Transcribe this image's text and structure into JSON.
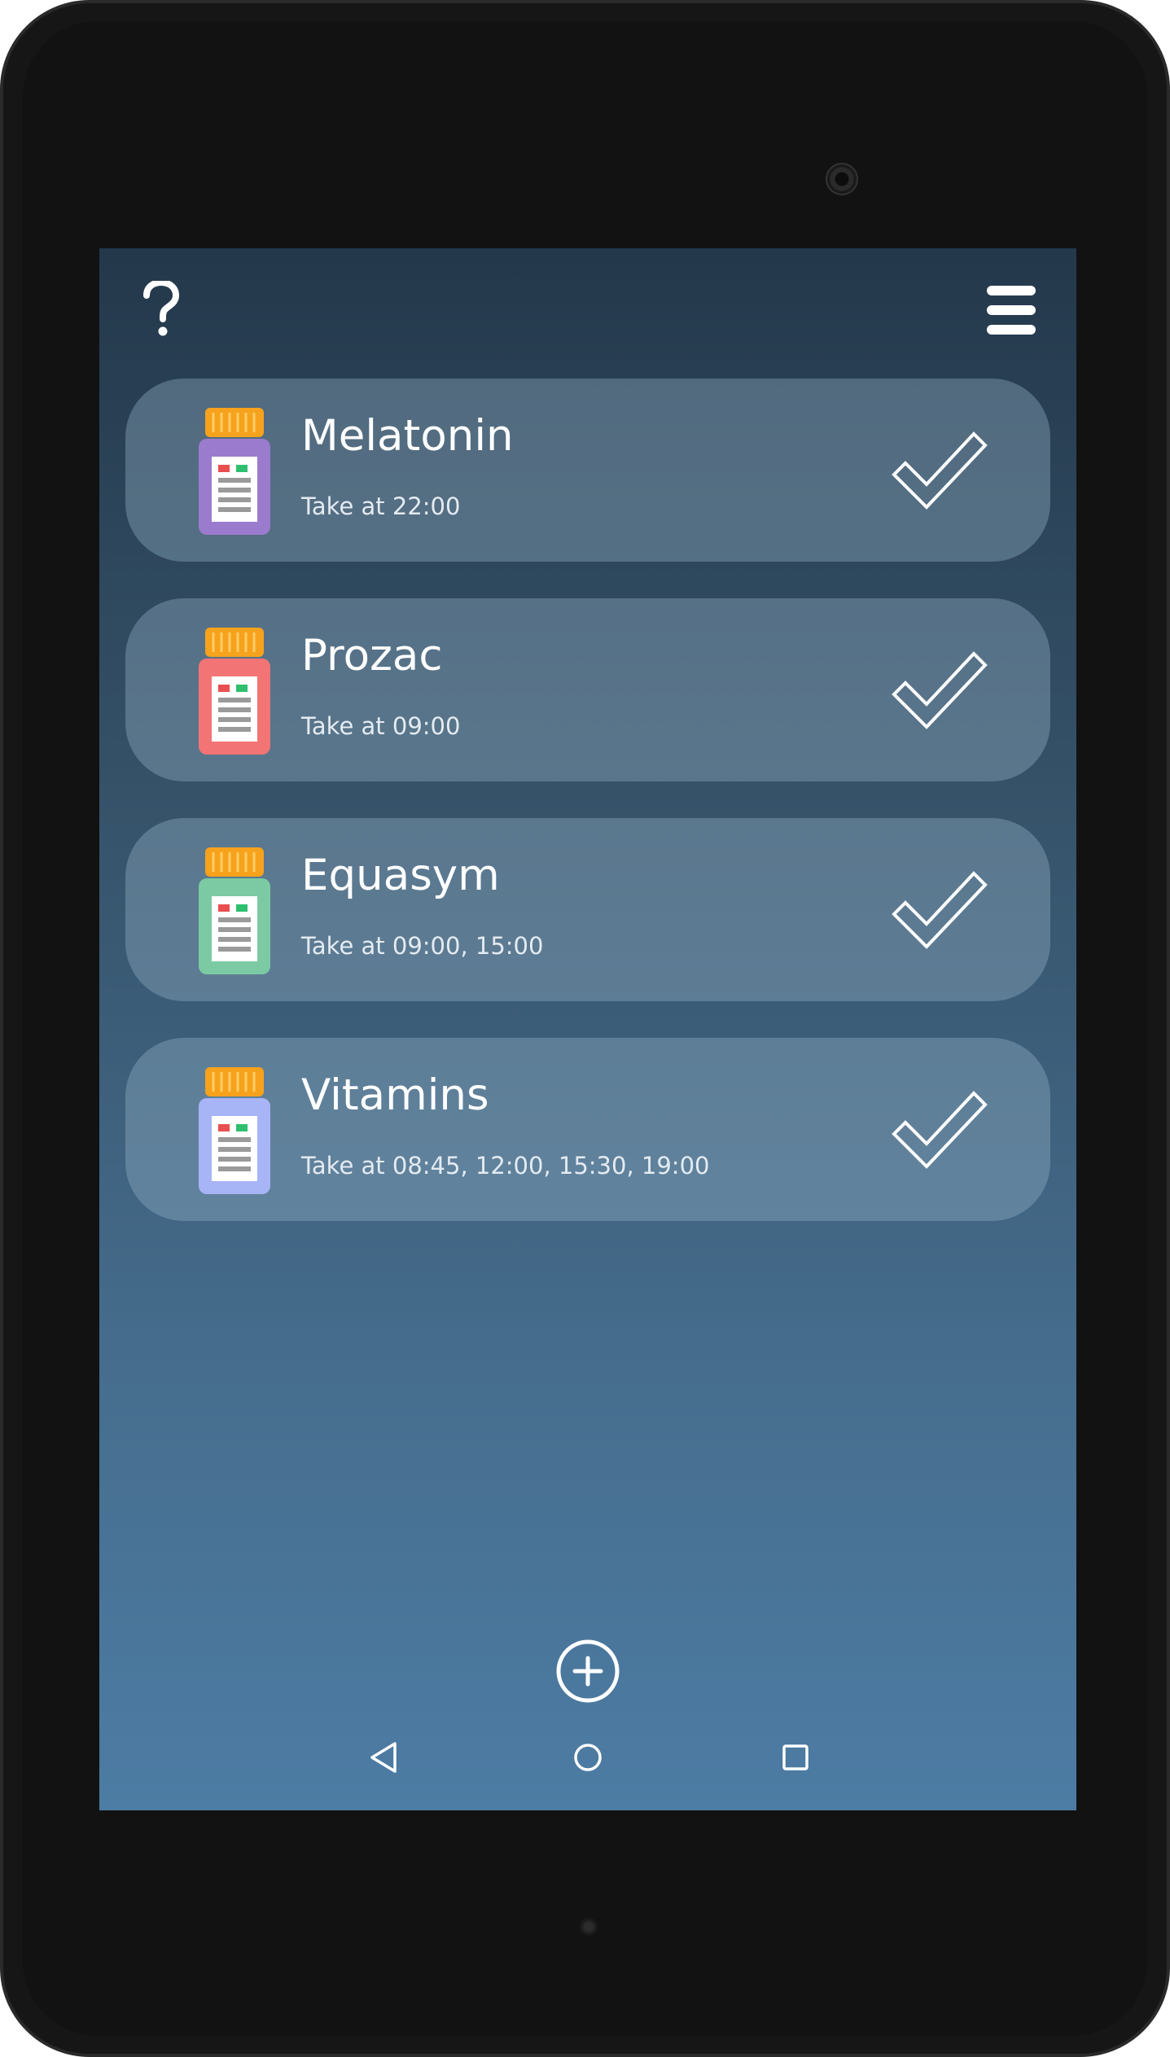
{
  "header": {
    "help_icon": "question-mark-icon",
    "menu_icon": "hamburger-menu-icon"
  },
  "medications": [
    {
      "name": "Melatonin",
      "schedule": "Take at 22:00",
      "bottle_color": "#9b7bcd"
    },
    {
      "name": "Prozac",
      "schedule": "Take at 09:00",
      "bottle_color": "#f37474"
    },
    {
      "name": "Equasym",
      "schedule": "Take at 09:00, 15:00",
      "bottle_color": "#7ccaa3"
    },
    {
      "name": "Vitamins",
      "schedule": "Take at 08:45, 12:00, 15:30, 19:00",
      "bottle_color": "#a7b4f5"
    }
  ],
  "icons": {
    "bottle": "medicine-bottle-icon",
    "taken": "checkmark-icon",
    "add": "add-circle-icon",
    "nav_back": "triangle-back-icon",
    "nav_home": "circle-home-icon",
    "nav_recents": "square-recents-icon"
  },
  "colors": {
    "cap": "#f7a21c",
    "card_bg": "rgba(150,178,200,0.38)",
    "screen_top": "#24384b",
    "screen_bottom": "#4d7ca4"
  }
}
